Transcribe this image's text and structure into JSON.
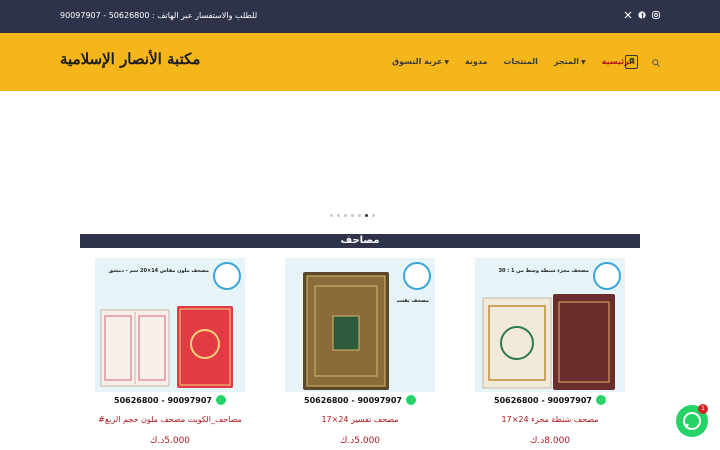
{
  "topbar": {
    "contact_text": "للطلب والاستفسار عبر الهاتف : 50626800 - 90097907",
    "social_icons": [
      "instagram-icon",
      "facebook-icon",
      "x-icon"
    ]
  },
  "header": {
    "logo_text": "مكتبة الأنصار الإسلامية",
    "cart_count": "0",
    "nav": [
      {
        "label": "الرئيسية",
        "active": true,
        "dropdown": false
      },
      {
        "label": "المتجر",
        "active": false,
        "dropdown": true
      },
      {
        "label": "المنتجات",
        "active": false,
        "dropdown": false
      },
      {
        "label": "مدونة",
        "active": false,
        "dropdown": false
      },
      {
        "label": "عربة التسوق",
        "active": false,
        "dropdown": true
      }
    ]
  },
  "slider": {
    "dot_count": 7,
    "active_dot": 6
  },
  "section": {
    "title": "مصاحف"
  },
  "products": [
    {
      "name": "مصحف شنطة مجزء 24×17",
      "price": "8.000د.ك",
      "caption": "مصحف مجزء شنطة وسط من 1 : 30",
      "phones": "50626800 - 90097907"
    },
    {
      "name": "مصحف تفسير 24×17",
      "price": "5.000د.ك",
      "caption": "مصحف تقسيم كلمات القرآن للشيخ",
      "phones": "50626800 - 90097907"
    },
    {
      "name": "مصاحف_الكويت مصحف ملون حجم الربع#",
      "price": "5.000د.ك",
      "caption": "مصحف ملون مقاس 14×20 سم - دمشق",
      "phones": "50626800 - 90097907"
    }
  ],
  "chat": {
    "badge": "1"
  },
  "colors": {
    "topbar": "#2e3349",
    "header": "#f5b61b",
    "accent": "#b1161c",
    "whatsapp": "#25d366"
  }
}
